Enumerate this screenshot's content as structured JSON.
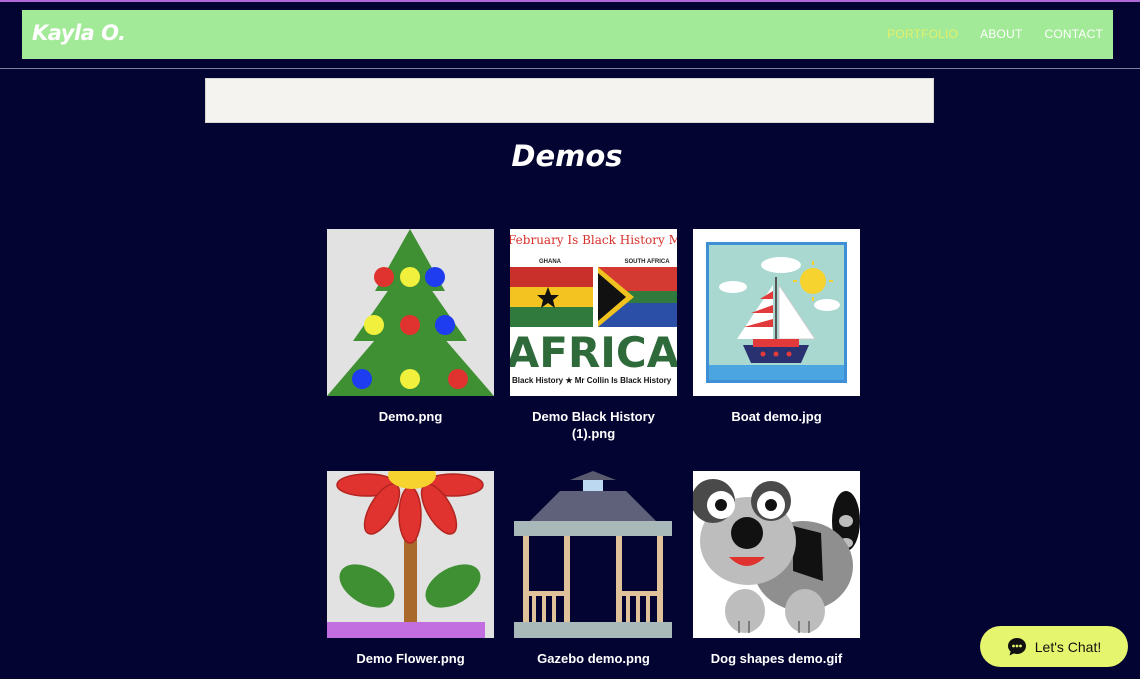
{
  "site": {
    "logo": "Kayla O.",
    "nav": [
      {
        "label": "PORTFOLIO",
        "active": true
      },
      {
        "label": "ABOUT",
        "active": false
      },
      {
        "label": "CONTACT",
        "active": false
      }
    ]
  },
  "main": {
    "title": "Demos",
    "gallery": [
      {
        "caption": "Demo.png",
        "icon": "christmas-tree"
      },
      {
        "caption": "Demo Black History (1).png",
        "icon": "black-history-flags"
      },
      {
        "caption": "Boat demo.jpg",
        "icon": "sailboat"
      },
      {
        "caption": "Demo Flower.png",
        "icon": "flower"
      },
      {
        "caption": "Gazebo demo.png",
        "icon": "gazebo"
      },
      {
        "caption": "Dog shapes demo.gif",
        "icon": "dog"
      }
    ],
    "flag_art": {
      "banner_text": "February Is Black History Month",
      "left_label": "GHANA",
      "right_label": "SOUTH AFRICA",
      "big_word": "AFRICA",
      "footer_text": "Black History ★ Mr Collin Is Black History"
    }
  },
  "chat": {
    "label": "Let's Chat!"
  },
  "colors": {
    "background": "#030432",
    "header": "#a3ea98",
    "nav_active": "#e3f06a",
    "chat_button": "#e6f56e"
  }
}
